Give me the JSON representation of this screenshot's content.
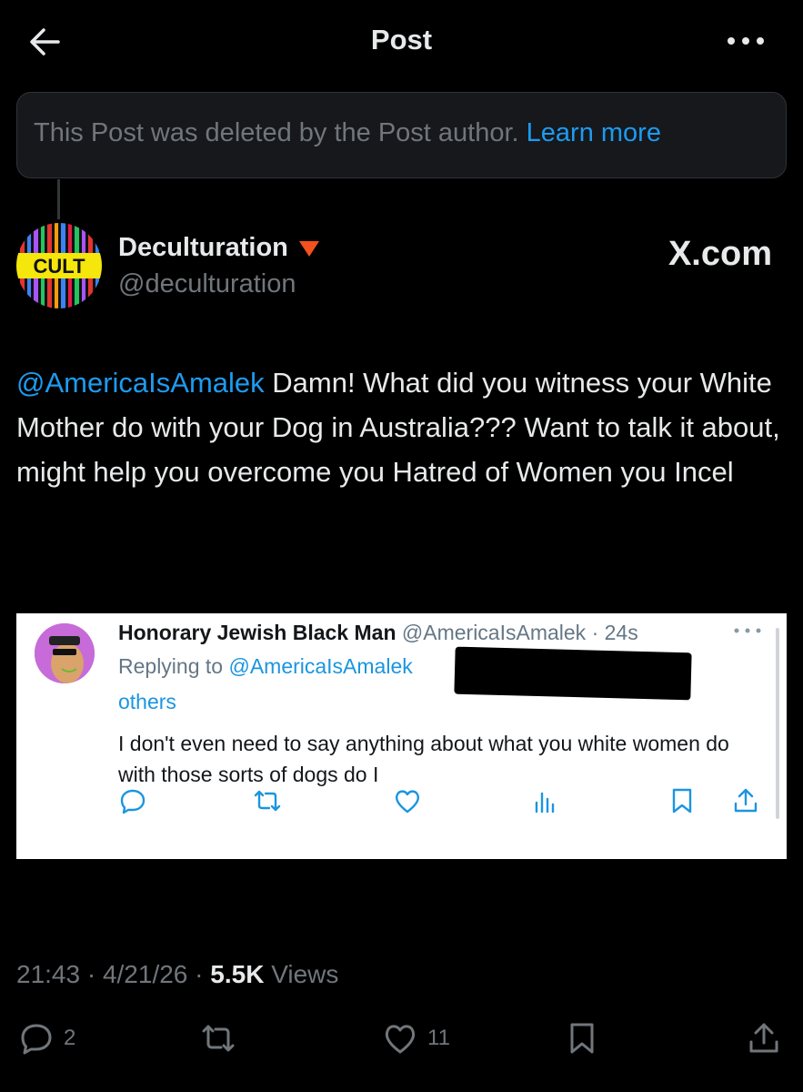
{
  "header": {
    "title": "Post",
    "back_icon": "arrow-left-icon",
    "more_icon": "more-horizontal-icon"
  },
  "deleted_notice": {
    "text": "This Post was deleted by the Post author.",
    "link": "Learn more"
  },
  "author": {
    "display_name": "Deculturation",
    "handle": "@deculturation",
    "avatar_text": "CULT",
    "badge_icon": "red-triangle-icon"
  },
  "watermark": "X.com",
  "tweet": {
    "mention": "@AmericaIsAmalek",
    "text": " Damn! What did you witness your White Mother do with your Dog in Australia??? Want to talk it about, might help you overcome you Hatred of Women you Incel"
  },
  "embedded_screenshot": {
    "display_name": "Honorary Jewish Black Man",
    "handle_time": " @AmericaIsAmalek · 24s",
    "replying_prefix": "Replying to ",
    "replying_handle": "@AmericaIsAmalek",
    "others": "others",
    "body": "I don't even need to say anything about what you white women do with those sorts of dogs do I",
    "icons": [
      "reply-icon",
      "retweet-icon",
      "like-icon",
      "analytics-icon",
      "bookmark-icon",
      "share-icon"
    ]
  },
  "meta": {
    "time": "21:43 · 4/21/26 · ",
    "views_count": "5.5K",
    "views_label": " Views"
  },
  "actions": {
    "replies": "2",
    "reposts": "",
    "likes": "11"
  },
  "colors": {
    "background": "#000000",
    "accent": "#1d9bf0",
    "secondary_text": "#71767b"
  }
}
